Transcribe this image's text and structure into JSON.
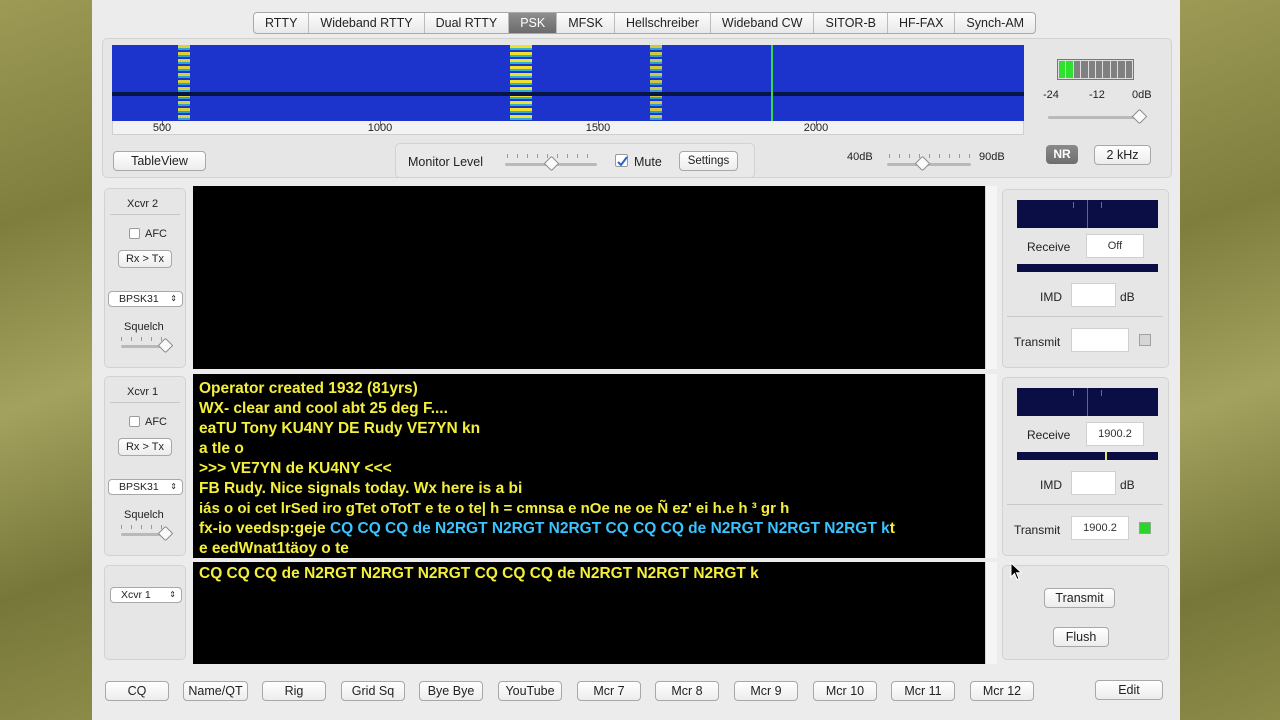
{
  "modes": [
    "RTTY",
    "Wideband RTTY",
    "Dual RTTY",
    "PSK",
    "MFSK",
    "Hellschreiber",
    "Wideband CW",
    "SITOR-B",
    "HF-FAX",
    "Synch-AM"
  ],
  "active_mode": "PSK",
  "waterfall": {
    "scale_labels": [
      "500",
      "1000",
      "1500",
      "2000"
    ],
    "cursor_freq_hz": 1900
  },
  "level_meter": {
    "scale": [
      "-24",
      "-12",
      "0dB"
    ]
  },
  "controls": {
    "table_view": "TableView",
    "monitor_level": "Monitor Level",
    "mute": "Mute",
    "mute_checked": true,
    "settings": "Settings",
    "range_low": "40dB",
    "range_high": "90dB",
    "nr": "NR",
    "bandwidth": "2 kHz"
  },
  "xcvr2": {
    "title": "Xcvr 2",
    "afc": "AFC",
    "rx_tx": "Rx > Tx",
    "mode": "BPSK31",
    "squelch": "Squelch",
    "receive_label": "Receive",
    "receive_value": "Off",
    "imd_label": "IMD",
    "imd_unit": "dB",
    "transmit_label": "Transmit"
  },
  "xcvr1": {
    "title": "Xcvr 1",
    "afc": "AFC",
    "rx_tx": "Rx > Tx",
    "mode": "BPSK31",
    "squelch": "Squelch",
    "receive_label": "Receive",
    "receive_value": "1900.2",
    "imd_label": "IMD",
    "imd_unit": "dB",
    "transmit_label": "Transmit",
    "transmit_value": "1900.2"
  },
  "rx1_text": {
    "lines": [
      "Operator created  1932 (81yrs)",
      "WX- clear and cool abt 25 deg F....",
      "eaTU Tony KU4NY DE Rudy VE7YN  kn",
      "a tIe o",
      " >>> VE7YN de KU4NY <<<",
      " FB Rudy.  Nice signals today.  Wx here is a bi",
      "iás o oi  cet lrSed  iro  gTet oTotT e te o te| h   = cmnsa e   nOe    ne oe Ñ ez' ei  h.e  h ³ gr h",
      "e eedWnat1täoy      o te"
    ],
    "mixed_line_prefix": "fx-io veedsp:geje ",
    "mixed_line_cyan": "CQ CQ CQ de N2RGT N2RGT N2RGT CQ CQ CQ de N2RGT N2RGT N2RGT k",
    "mixed_line_suffix": "t"
  },
  "tx_text": "CQ CQ CQ de N2RGT N2RGT N2RGT CQ CQ CQ de N2RGT N2RGT N2RGT k",
  "tx_panel": {
    "target": "Xcvr 1",
    "transmit": "Transmit",
    "flush": "Flush"
  },
  "macros": [
    "CQ",
    "Name/QT",
    "Rig",
    "Grid Sq",
    "Bye Bye",
    "YouTube",
    "Mcr 7",
    "Mcr 8",
    "Mcr 9",
    "Mcr 10",
    "Mcr 11",
    "Mcr 12"
  ],
  "edit": "Edit"
}
